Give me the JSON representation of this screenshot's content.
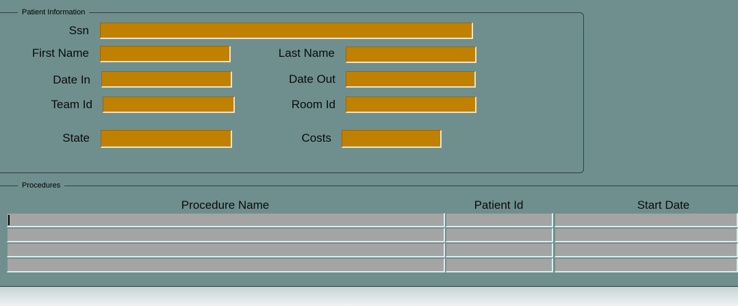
{
  "patient_info": {
    "legend": "Patient Information",
    "labels": {
      "ssn": "Ssn",
      "first_name": "First Name",
      "last_name": "Last Name",
      "date_in": "Date In",
      "date_out": "Date Out",
      "team_id": "Team Id",
      "room_id": "Room Id",
      "state": "State",
      "costs": "Costs"
    },
    "values": {
      "ssn": "",
      "first_name": "",
      "last_name": "",
      "date_in": "",
      "date_out": "",
      "team_id": "",
      "room_id": "",
      "state": "",
      "costs": ""
    }
  },
  "procedures": {
    "legend": "Procedures",
    "columns": [
      "Procedure Name",
      "Patient Id",
      "Start Date"
    ],
    "rows": [
      [
        "",
        "",
        ""
      ],
      [
        "",
        "",
        ""
      ],
      [
        "",
        "",
        ""
      ],
      [
        "",
        "",
        ""
      ]
    ]
  },
  "colors": {
    "background": "#6f8f8f",
    "field_fill": "#c08000",
    "table_cell_fill": "#a4a4a4"
  }
}
